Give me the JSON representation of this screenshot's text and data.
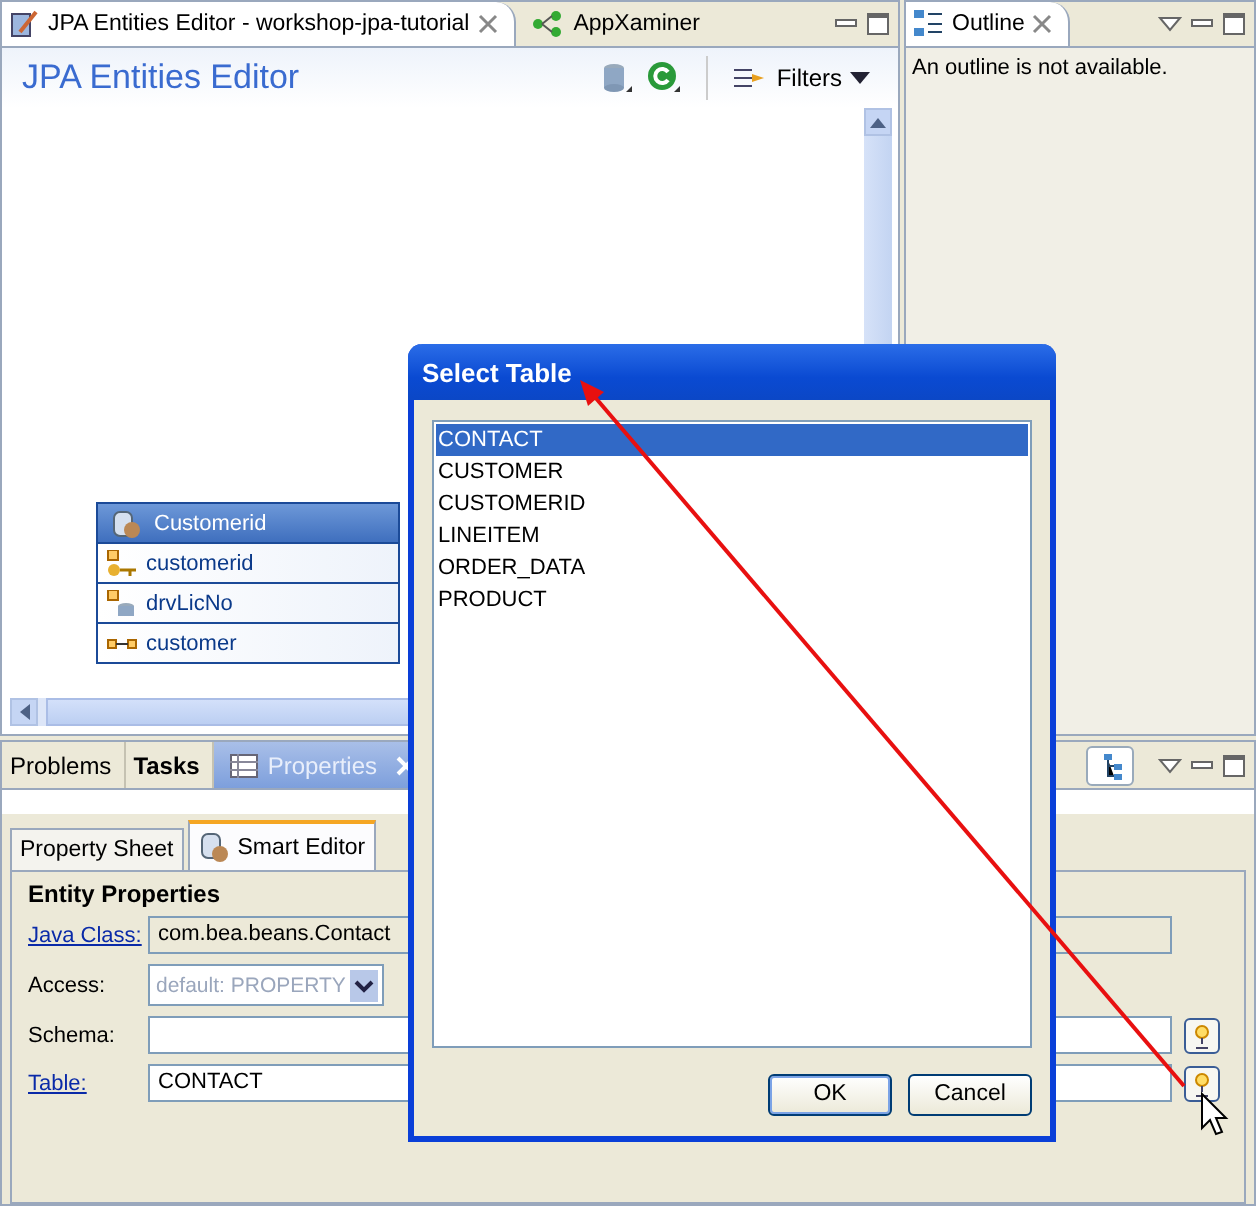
{
  "editor_tabs": [
    {
      "label": "JPA Entities Editor - workshop-jpa-tutorial",
      "selected": true
    },
    {
      "label": "AppXaminer",
      "selected": false
    }
  ],
  "editor": {
    "title": "JPA Entities Editor",
    "filters": "Filters",
    "entity": {
      "name": "Customerid",
      "fields": [
        {
          "name": "customerid",
          "kind": "key"
        },
        {
          "name": "drvLicNo",
          "kind": "column"
        },
        {
          "name": "customer",
          "kind": "relation"
        }
      ]
    }
  },
  "outline": {
    "tab": "Outline",
    "message": "An outline is not available."
  },
  "bottom_tabs": [
    {
      "label": "Problems",
      "selected": false,
      "bold": false
    },
    {
      "label": "Tasks",
      "selected": false,
      "bold": true
    },
    {
      "label": "Properties",
      "selected": true,
      "bold": false
    }
  ],
  "property_tabs": [
    {
      "label": "Property Sheet",
      "selected": false
    },
    {
      "label": "Smart Editor",
      "selected": true
    }
  ],
  "section": {
    "title": "Entity Properties",
    "rows": [
      {
        "label": "Java Class:",
        "kind": "text",
        "link": true,
        "value": "com.bea.beans.Contact",
        "readonly": true,
        "browse": false
      },
      {
        "label": "Access:",
        "kind": "select",
        "link": false,
        "value": "default: PROPERTY",
        "disabled": true,
        "browse": false
      },
      {
        "label": "Schema:",
        "kind": "text",
        "link": false,
        "readonly": false,
        "browse": true
      },
      {
        "label": "Table:",
        "kind": "text",
        "link": true,
        "value": "CONTACT",
        "readonly": false,
        "browse": true
      }
    ]
  },
  "dialog": {
    "title": "Select Table",
    "items": [
      {
        "label": "CONTACT",
        "selected": true
      },
      {
        "label": "CUSTOMER",
        "selected": false
      },
      {
        "label": "CUSTOMERID",
        "selected": false
      },
      {
        "label": "LINEITEM",
        "selected": false
      },
      {
        "label": "ORDER_DATA",
        "selected": false
      },
      {
        "label": "PRODUCT",
        "selected": false
      }
    ],
    "buttons": [
      "OK",
      "Cancel"
    ]
  }
}
